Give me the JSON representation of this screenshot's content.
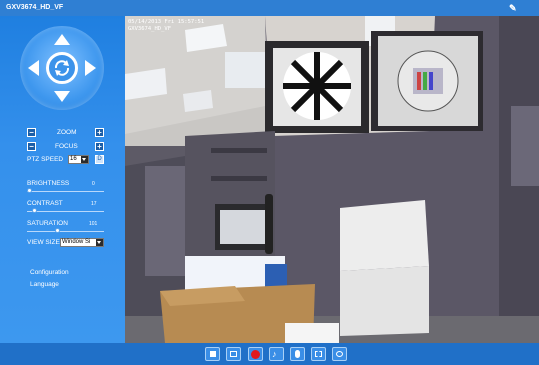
{
  "window": {
    "title": "GXV3674_HD_VF"
  },
  "video": {
    "timestamp": "05/14/2013 Fri 15:57:51",
    "camera_name": "GXV3674_HD_VF"
  },
  "controls": {
    "zoom_label": "ZOOM",
    "focus_label": "FOCUS",
    "minus": "−",
    "plus": "+",
    "ptz_speed_label": "PTZ SPEED",
    "ptz_speed_value": "16",
    "ptz_d": "D",
    "brightness_label": "BRIGHTNESS",
    "brightness_value": "0",
    "contrast_label": "CONTRAST",
    "contrast_value": "17",
    "saturation_label": "SATURATION",
    "saturation_value": "101",
    "view_size_label": "VIEW SIZE",
    "view_size_value": "Window Si"
  },
  "links": {
    "configuration": "Configuration",
    "language": "Language"
  },
  "toolbar": {
    "buttons": [
      "stop-icon",
      "snapshot-icon",
      "record-icon",
      "audio-icon",
      "microphone-icon",
      "fullscreen-icon",
      "settings-icon"
    ]
  },
  "colors": {
    "accent": "#2f7fd3",
    "record": "#e0191c"
  }
}
